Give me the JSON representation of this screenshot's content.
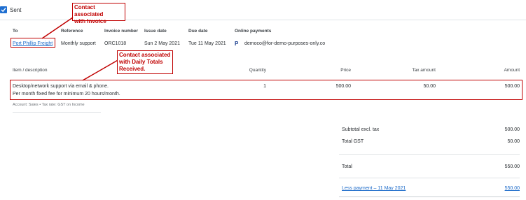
{
  "status": {
    "sent_label": "Sent"
  },
  "annotations": {
    "invoice_contact": "Contact associated\nwith Invoice",
    "daily_totals_contact": "Contact associated\nwith Daily Totals\nReceived."
  },
  "invoice": {
    "headers": {
      "to": "To",
      "reference": "Reference",
      "invoice_number": "Invoice number",
      "issue_date": "Issue date",
      "due_date": "Due date",
      "online_payments": "Online payments"
    },
    "to": "Port Phillip Freight",
    "reference": "Monthly support",
    "invoice_number": "ORC1018",
    "issue_date": "Sun 2 May 2021",
    "due_date": "Tue 11 May 2021",
    "online_payments_icon": "paypal-icon",
    "online_payments_email": "democo@for-demo-purposes-only.co"
  },
  "line_items": {
    "columns": {
      "item": "Item / description",
      "quantity": "Quantity",
      "price": "Price",
      "tax_amount": "Tax amount",
      "amount": "Amount"
    },
    "rows": [
      {
        "description_line1": "Desktop/network support via email & phone.",
        "description_line2": "Per month fixed fee for minimum 20 hours/month.",
        "quantity": "1",
        "price": "500.00",
        "tax_amount": "50.00",
        "amount": "500.00",
        "account_info": "Account: Sales • Tax rate: GST on Income"
      }
    ]
  },
  "totals": {
    "subtotal_label": "Subtotal excl. tax",
    "subtotal_value": "500.00",
    "gst_label": "Total GST",
    "gst_value": "50.00",
    "total_label": "Total",
    "total_value": "550.00",
    "payment_label": "Less payment – 11 May 2021",
    "payment_value": "550.00"
  },
  "colors": {
    "accent": "#1f6fd1",
    "link": "#1b6ac9",
    "annotation_red": "#c00000"
  }
}
